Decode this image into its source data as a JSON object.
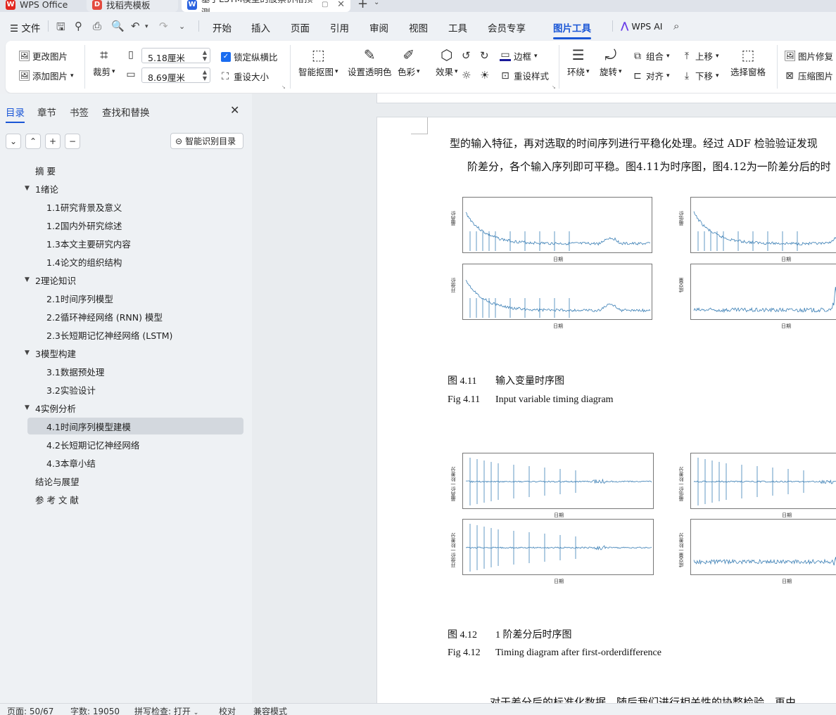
{
  "tabs": {
    "app": "WPS Office",
    "template": "找稻壳模板",
    "document": "基于LSTM模型的股票价格预测"
  },
  "menu": {
    "file": "文件",
    "items": [
      "开始",
      "插入",
      "页面",
      "引用",
      "审阅",
      "视图",
      "工具",
      "会员专享",
      "图片工具"
    ],
    "wps_ai": "WPS AI"
  },
  "ribbon": {
    "change_image": "更改图片",
    "add_image": "添加图片",
    "crop": "裁剪",
    "width": "5.18厘米",
    "height": "8.69厘米",
    "lock_ratio": "锁定纵横比",
    "reset_size": "重设大小",
    "smart_cutout": "智能抠图",
    "set_transparent": "设置透明色",
    "color": "色彩",
    "effects": "效果",
    "border": "边框",
    "reset_style": "重设样式",
    "wrap": "环绕",
    "rotate": "旋转",
    "group": "组合",
    "align": "对齐",
    "bring_forward": "上移",
    "send_backward": "下移",
    "selection_pane": "选择窗格",
    "image_repair": "图片修复",
    "compress_image": "压缩图片"
  },
  "sidebar": {
    "tabs": [
      "目录",
      "章节",
      "书签",
      "查找和替换"
    ],
    "smart_toc": "智能识别目录",
    "toc": [
      {
        "label": "摘  要",
        "level": 0,
        "expand": false
      },
      {
        "label": "1绪论",
        "level": 0,
        "expand": true
      },
      {
        "label": "1.1研究背景及意义",
        "level": 1
      },
      {
        "label": "1.2国内外研究综述",
        "level": 1
      },
      {
        "label": "1.3本文主要研究内容",
        "level": 1
      },
      {
        "label": "1.4论文的组织结构",
        "level": 1
      },
      {
        "label": "2理论知识",
        "level": 0,
        "expand": true
      },
      {
        "label": "2.1时间序列模型",
        "level": 1
      },
      {
        "label": "2.2循环神经网络 (RNN) 模型",
        "level": 1
      },
      {
        "label": "2.3长短期记忆神经网络 (LSTM)",
        "level": 1
      },
      {
        "label": "3模型构建",
        "level": 0,
        "expand": true
      },
      {
        "label": "3.1数据预处理",
        "level": 1
      },
      {
        "label": "3.2实验设计",
        "level": 1
      },
      {
        "label": "4实例分析",
        "level": 0,
        "expand": true
      },
      {
        "label": "4.1时间序列模型建模",
        "level": 1,
        "selected": true
      },
      {
        "label": "4.2长短期记忆神经网络",
        "level": 1
      },
      {
        "label": "4.3本章小结",
        "level": 1
      },
      {
        "label": "结论与展望",
        "level": 0,
        "expand": false
      },
      {
        "label": "参 考 文 献",
        "level": 0,
        "expand": false
      }
    ]
  },
  "document": {
    "line1": "型的输入特征，再对选取的时间序列进行平稳化处理。经过 ADF 检验验证发现",
    "line2": "阶差分，各个输入序列即可平稳。图4.11为时序图，图4.12为一阶差分后的时",
    "fig11_num_cn": "图 4.11",
    "fig11_cn": "输入变量时序图",
    "fig11_num_en": "Fig 4.11",
    "fig11_en": "Input variable timing diagram",
    "fig12_num_cn": "图 4.12",
    "fig12_cn": "1 阶差分后时序图",
    "fig12_num_en": "Fig 4.12",
    "fig12_en": "Timing diagram after first-orderdifference",
    "bottom_line": "对于差分后的标准化数据，随后我们进行相关性的协整检验，再由",
    "plot_xlabel": "日期",
    "plots_fig11": [
      "最高价",
      "最低价",
      "开盘价",
      "成交量"
    ],
    "plots_fig12": [
      "最高价一阶差分",
      "最低价一阶差分",
      "开盘价一阶差分",
      "成交量一阶差分"
    ]
  },
  "status": {
    "page": "页面: 50/67",
    "words": "字数: 19050",
    "spell": "拼写检查: 打开",
    "proof": "校对",
    "compat": "兼容模式"
  },
  "colors": {
    "accent": "#1a56d6",
    "plot_line": "#3b7fb5"
  }
}
